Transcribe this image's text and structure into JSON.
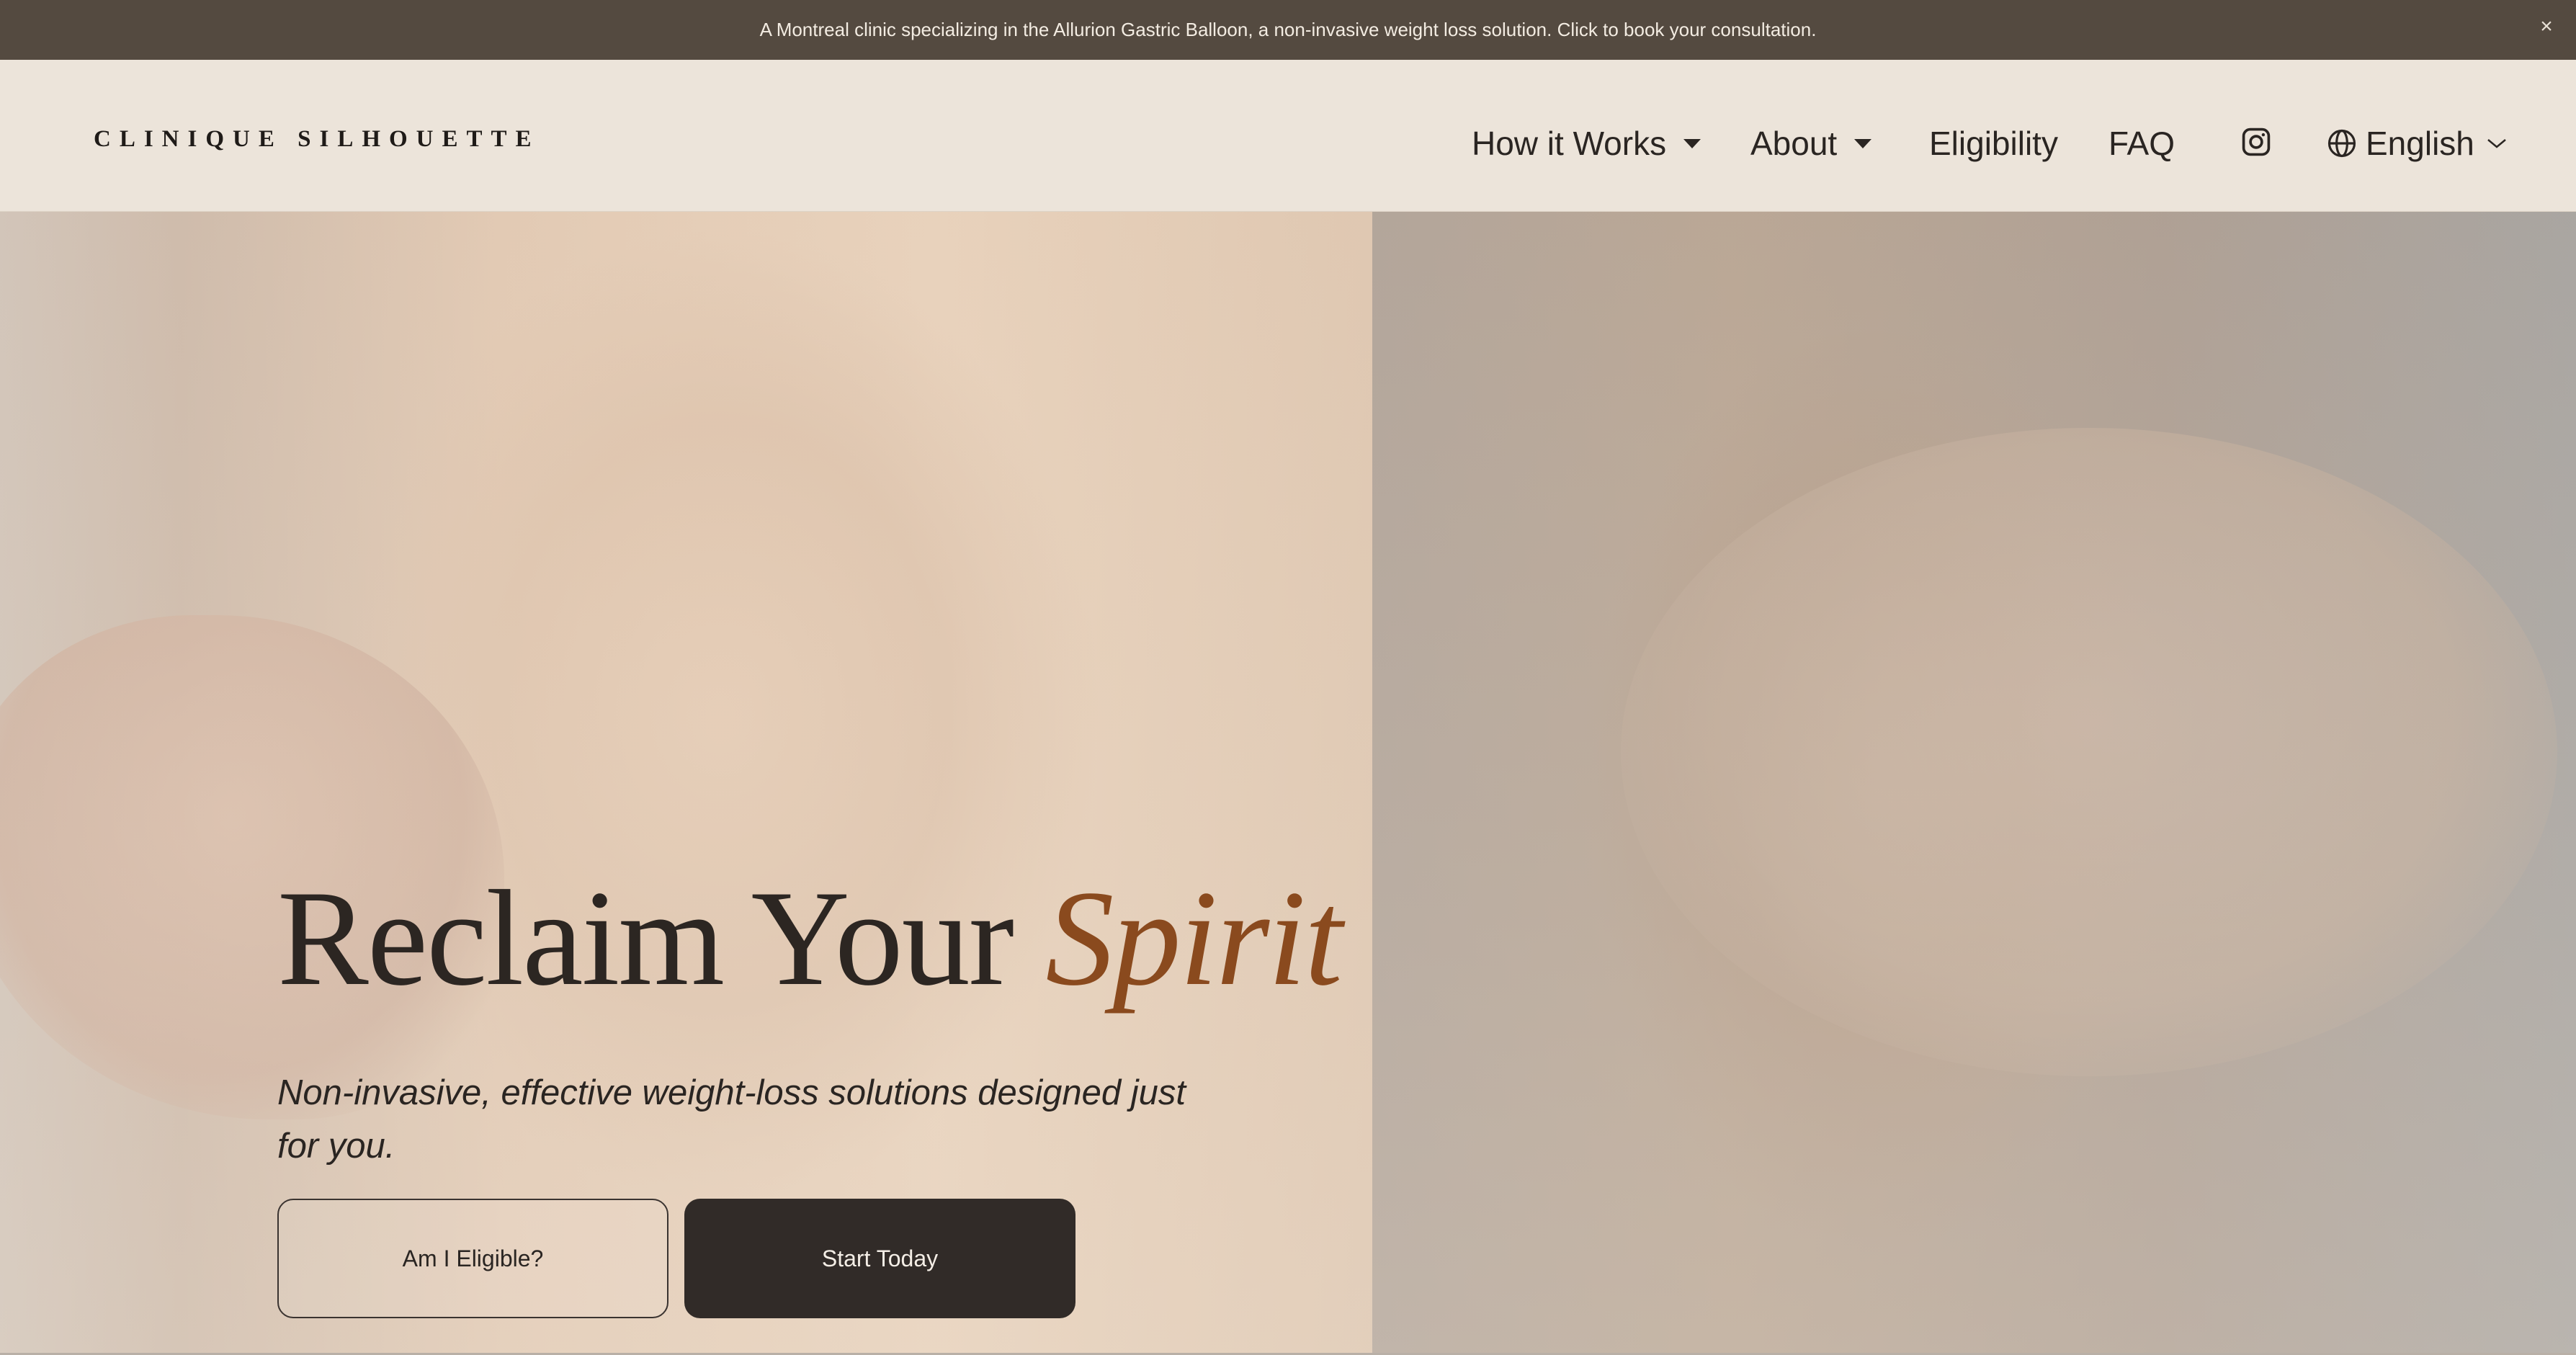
{
  "announcement": {
    "text": "A Montreal clinic specializing in the Allurion Gastric Balloon, a non-invasive weight loss solution. Click to book your consultation.",
    "close_label": "×"
  },
  "header": {
    "logo": "CLINIQUE SILHOUETTE",
    "nav": {
      "how_it_works": "How it Works",
      "about": "About",
      "eligibility": "Eligibility",
      "faq": "FAQ",
      "language": "English"
    },
    "icons": [
      "instagram-icon",
      "globe-icon",
      "chevron-down-icon"
    ]
  },
  "hero": {
    "title_main": "Reclaim Your ",
    "title_accent": "Spirit",
    "subtitle": "Non-invasive, effective weight-loss solutions designed just for you.",
    "btn_eligible": "Am I Eligible?",
    "btn_start": "Start Today"
  },
  "colors": {
    "announcement_bg": "#544a40",
    "header_bg": "#ece4da",
    "accent": "#8a4a1e",
    "button_dark": "#312b28",
    "text_dark": "#2a2522"
  }
}
